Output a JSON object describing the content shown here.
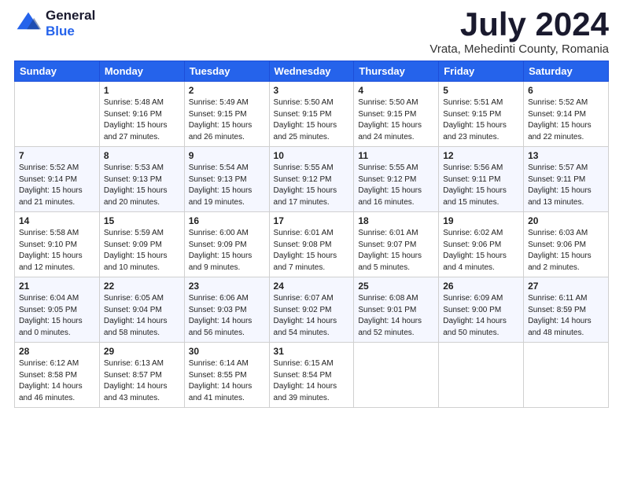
{
  "header": {
    "logo_general": "General",
    "logo_blue": "Blue",
    "month": "July 2024",
    "location": "Vrata, Mehedinti County, Romania"
  },
  "weekdays": [
    "Sunday",
    "Monday",
    "Tuesday",
    "Wednesday",
    "Thursday",
    "Friday",
    "Saturday"
  ],
  "weeks": [
    [
      {
        "day": "",
        "info": ""
      },
      {
        "day": "1",
        "info": "Sunrise: 5:48 AM\nSunset: 9:16 PM\nDaylight: 15 hours\nand 27 minutes."
      },
      {
        "day": "2",
        "info": "Sunrise: 5:49 AM\nSunset: 9:15 PM\nDaylight: 15 hours\nand 26 minutes."
      },
      {
        "day": "3",
        "info": "Sunrise: 5:50 AM\nSunset: 9:15 PM\nDaylight: 15 hours\nand 25 minutes."
      },
      {
        "day": "4",
        "info": "Sunrise: 5:50 AM\nSunset: 9:15 PM\nDaylight: 15 hours\nand 24 minutes."
      },
      {
        "day": "5",
        "info": "Sunrise: 5:51 AM\nSunset: 9:15 PM\nDaylight: 15 hours\nand 23 minutes."
      },
      {
        "day": "6",
        "info": "Sunrise: 5:52 AM\nSunset: 9:14 PM\nDaylight: 15 hours\nand 22 minutes."
      }
    ],
    [
      {
        "day": "7",
        "info": "Sunrise: 5:52 AM\nSunset: 9:14 PM\nDaylight: 15 hours\nand 21 minutes."
      },
      {
        "day": "8",
        "info": "Sunrise: 5:53 AM\nSunset: 9:13 PM\nDaylight: 15 hours\nand 20 minutes."
      },
      {
        "day": "9",
        "info": "Sunrise: 5:54 AM\nSunset: 9:13 PM\nDaylight: 15 hours\nand 19 minutes."
      },
      {
        "day": "10",
        "info": "Sunrise: 5:55 AM\nSunset: 9:12 PM\nDaylight: 15 hours\nand 17 minutes."
      },
      {
        "day": "11",
        "info": "Sunrise: 5:55 AM\nSunset: 9:12 PM\nDaylight: 15 hours\nand 16 minutes."
      },
      {
        "day": "12",
        "info": "Sunrise: 5:56 AM\nSunset: 9:11 PM\nDaylight: 15 hours\nand 15 minutes."
      },
      {
        "day": "13",
        "info": "Sunrise: 5:57 AM\nSunset: 9:11 PM\nDaylight: 15 hours\nand 13 minutes."
      }
    ],
    [
      {
        "day": "14",
        "info": "Sunrise: 5:58 AM\nSunset: 9:10 PM\nDaylight: 15 hours\nand 12 minutes."
      },
      {
        "day": "15",
        "info": "Sunrise: 5:59 AM\nSunset: 9:09 PM\nDaylight: 15 hours\nand 10 minutes."
      },
      {
        "day": "16",
        "info": "Sunrise: 6:00 AM\nSunset: 9:09 PM\nDaylight: 15 hours\nand 9 minutes."
      },
      {
        "day": "17",
        "info": "Sunrise: 6:01 AM\nSunset: 9:08 PM\nDaylight: 15 hours\nand 7 minutes."
      },
      {
        "day": "18",
        "info": "Sunrise: 6:01 AM\nSunset: 9:07 PM\nDaylight: 15 hours\nand 5 minutes."
      },
      {
        "day": "19",
        "info": "Sunrise: 6:02 AM\nSunset: 9:06 PM\nDaylight: 15 hours\nand 4 minutes."
      },
      {
        "day": "20",
        "info": "Sunrise: 6:03 AM\nSunset: 9:06 PM\nDaylight: 15 hours\nand 2 minutes."
      }
    ],
    [
      {
        "day": "21",
        "info": "Sunrise: 6:04 AM\nSunset: 9:05 PM\nDaylight: 15 hours\nand 0 minutes."
      },
      {
        "day": "22",
        "info": "Sunrise: 6:05 AM\nSunset: 9:04 PM\nDaylight: 14 hours\nand 58 minutes."
      },
      {
        "day": "23",
        "info": "Sunrise: 6:06 AM\nSunset: 9:03 PM\nDaylight: 14 hours\nand 56 minutes."
      },
      {
        "day": "24",
        "info": "Sunrise: 6:07 AM\nSunset: 9:02 PM\nDaylight: 14 hours\nand 54 minutes."
      },
      {
        "day": "25",
        "info": "Sunrise: 6:08 AM\nSunset: 9:01 PM\nDaylight: 14 hours\nand 52 minutes."
      },
      {
        "day": "26",
        "info": "Sunrise: 6:09 AM\nSunset: 9:00 PM\nDaylight: 14 hours\nand 50 minutes."
      },
      {
        "day": "27",
        "info": "Sunrise: 6:11 AM\nSunset: 8:59 PM\nDaylight: 14 hours\nand 48 minutes."
      }
    ],
    [
      {
        "day": "28",
        "info": "Sunrise: 6:12 AM\nSunset: 8:58 PM\nDaylight: 14 hours\nand 46 minutes."
      },
      {
        "day": "29",
        "info": "Sunrise: 6:13 AM\nSunset: 8:57 PM\nDaylight: 14 hours\nand 43 minutes."
      },
      {
        "day": "30",
        "info": "Sunrise: 6:14 AM\nSunset: 8:55 PM\nDaylight: 14 hours\nand 41 minutes."
      },
      {
        "day": "31",
        "info": "Sunrise: 6:15 AM\nSunset: 8:54 PM\nDaylight: 14 hours\nand 39 minutes."
      },
      {
        "day": "",
        "info": ""
      },
      {
        "day": "",
        "info": ""
      },
      {
        "day": "",
        "info": ""
      }
    ]
  ]
}
